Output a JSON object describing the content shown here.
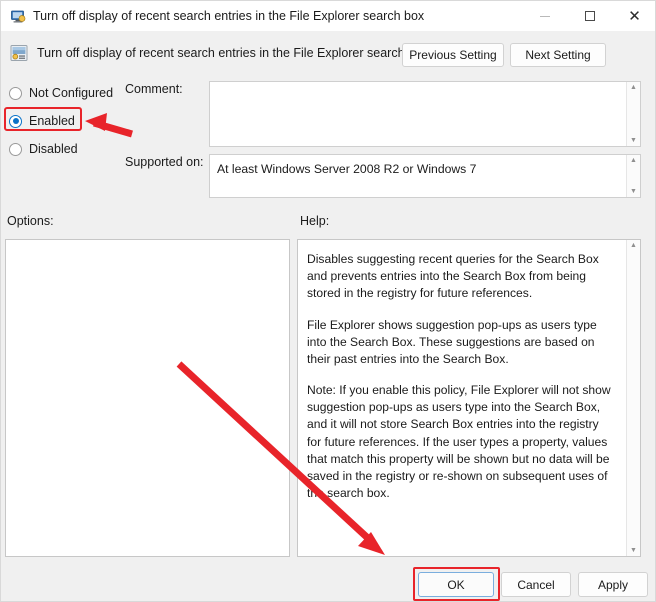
{
  "window": {
    "title": "Turn off display of recent search entries in the File Explorer search box",
    "title_icon": "policy-setting-icon",
    "controls": {
      "minimize": "minimize-icon",
      "maximize": "maximize-icon",
      "close": "close-icon"
    }
  },
  "header": {
    "icon": "policy-setting-icon",
    "title": "Turn off display of recent search entries in the File Explorer search box",
    "previous_setting": "Previous Setting",
    "next_setting": "Next Setting"
  },
  "state_options": {
    "not_configured": "Not Configured",
    "enabled": "Enabled",
    "disabled": "Disabled",
    "selected": "Enabled"
  },
  "fields": {
    "comment_label": "Comment:",
    "comment_value": "",
    "supported_label": "Supported on:",
    "supported_value": "At least Windows Server 2008 R2 or Windows 7"
  },
  "panels": {
    "options_label": "Options:",
    "options_value": "",
    "help_label": "Help:",
    "help_paragraphs": [
      "Disables suggesting recent queries for the Search Box and prevents entries into the Search Box from being stored in the registry for future references.",
      "File Explorer shows suggestion pop-ups as users type into the Search Box.  These suggestions are based on their past entries into the Search Box.",
      "Note: If you enable this policy, File Explorer will not show suggestion pop-ups as users type into the Search Box, and it will not store Search Box entries into the registry for future references.  If the user types a property, values that match this property will be shown but no data will be saved in the registry or re-shown on subsequent uses of the search box."
    ]
  },
  "footer": {
    "ok": "OK",
    "cancel": "Cancel",
    "apply": "Apply"
  },
  "annotations": {
    "highlight_color": "#e8242a",
    "arrow_to_enabled": "red-arrow-pointing-left-at-enabled",
    "arrow_to_ok": "red-arrow-pointing-down-right-at-ok"
  },
  "scroll": {
    "up": "▲",
    "down": "▼"
  }
}
